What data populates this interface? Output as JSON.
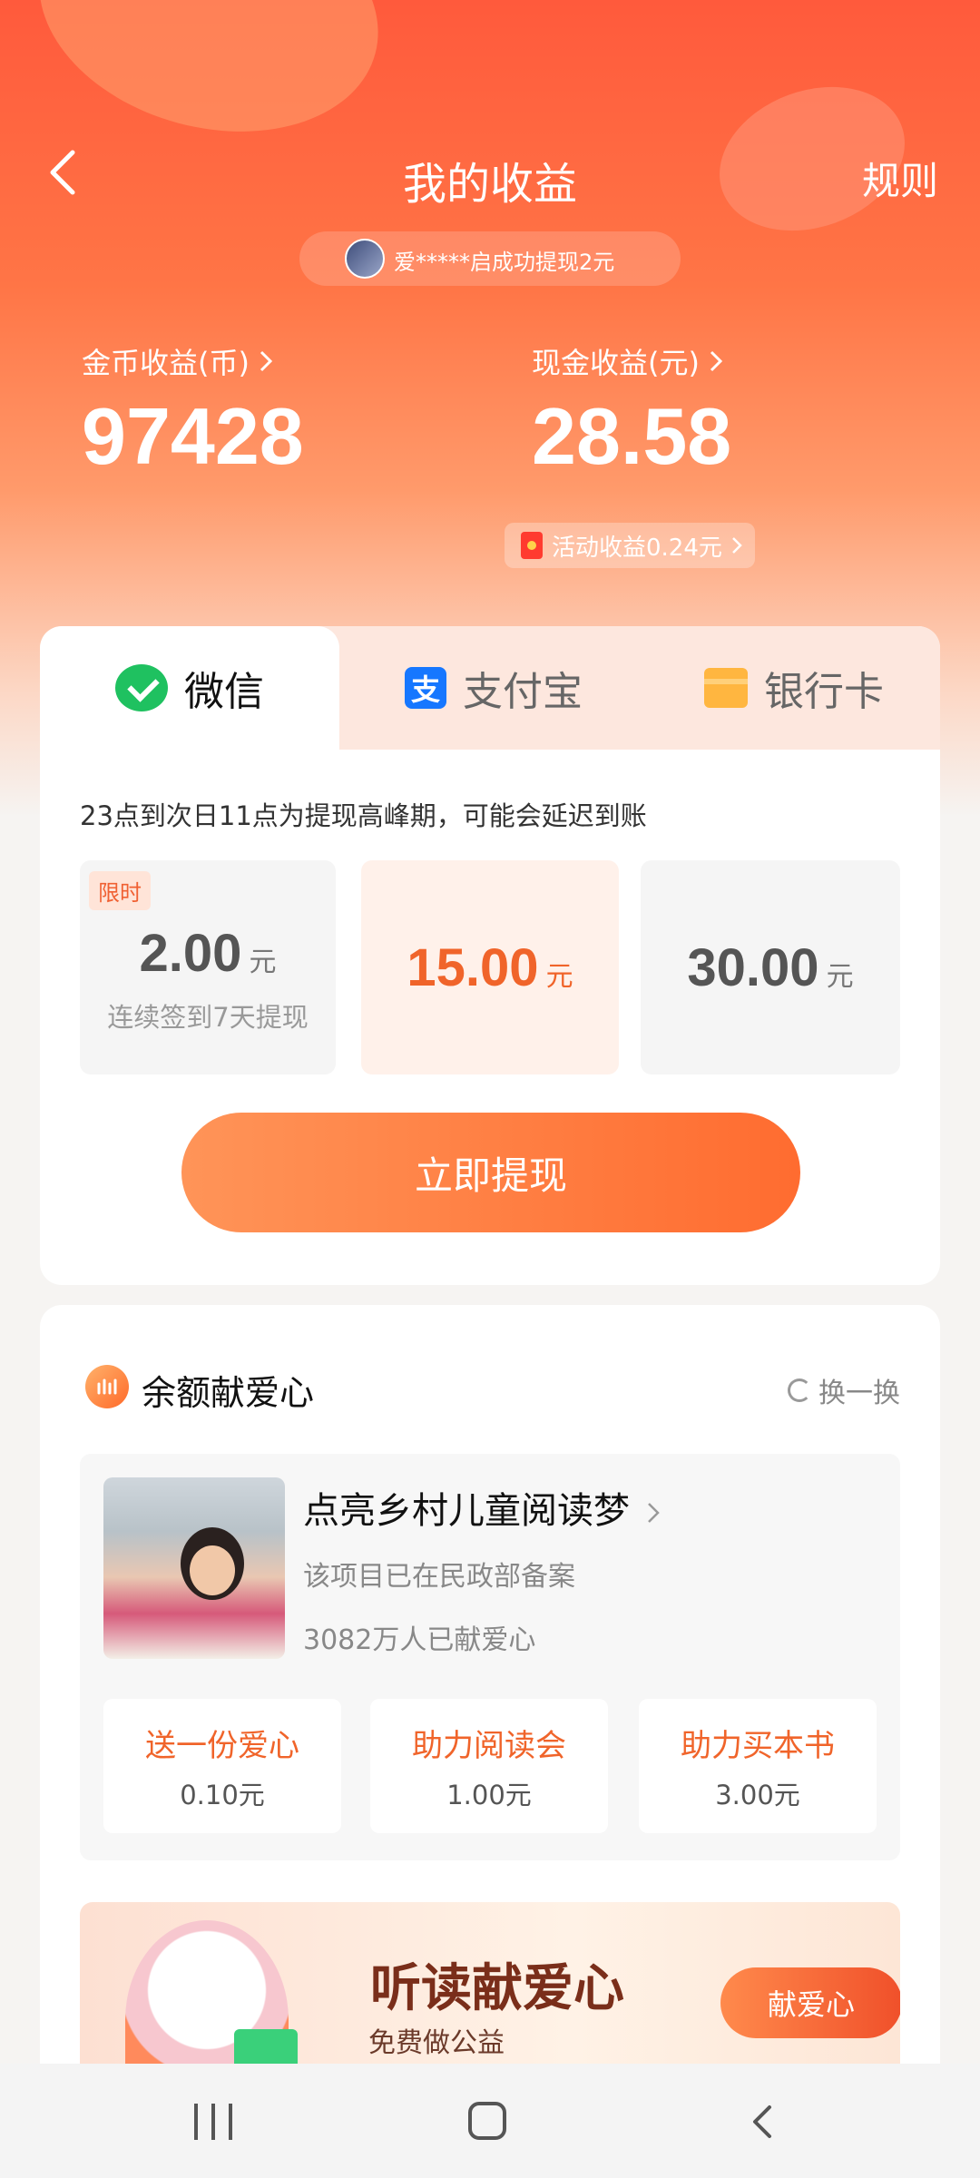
{
  "header": {
    "title": "我的收益",
    "rules_label": "规则",
    "ticker_text": "爱*****启成功提现2元"
  },
  "stats": {
    "coins_label": "金币收益(币)",
    "coins_value": "97428",
    "cash_label": "现金收益(元)",
    "cash_value": "28.58",
    "activity_label": "活动收益0.24元"
  },
  "withdraw": {
    "tabs": [
      {
        "label": "微信",
        "icon": "wechat-icon",
        "active": true
      },
      {
        "label": "支付宝",
        "icon": "alipay-icon",
        "active": false
      },
      {
        "label": "银行卡",
        "icon": "bank-card-icon",
        "active": false
      }
    ],
    "alipay_glyph": "支",
    "notice": "23点到次日11点为提现高峰期，可能会延迟到账",
    "amounts": [
      {
        "value": "2.00",
        "unit": "元",
        "tag": "限时",
        "sub": "连续签到7天提现"
      },
      {
        "value": "15.00",
        "unit": "元",
        "selected": true
      },
      {
        "value": "30.00",
        "unit": "元"
      }
    ],
    "cta_label": "立即提现"
  },
  "charity": {
    "title": "余额献爱心",
    "refresh_label": "换一换",
    "project": {
      "name": "点亮乡村儿童阅读梦",
      "desc": "该项目已在民政部备案",
      "count": "3082万人已献爱心"
    },
    "options": [
      {
        "label": "送一份爱心",
        "price": "0.10元"
      },
      {
        "label": "助力阅读会",
        "price": "1.00元"
      },
      {
        "label": "助力买本书",
        "price": "3.00元"
      }
    ],
    "banner": {
      "title": "听读献爱心",
      "subtitle": "免费做公益",
      "button_label": "献爱心"
    }
  },
  "colors": {
    "accent": "#f0642a",
    "header_top": "#ff5a3c",
    "wechat_green": "#1fc160",
    "alipay_blue": "#1677ff",
    "bank_yellow": "#ffb640"
  }
}
